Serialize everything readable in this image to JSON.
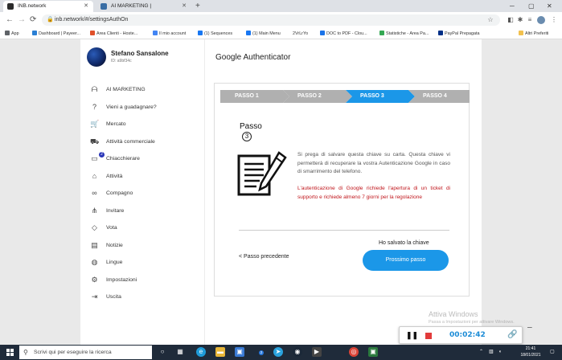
{
  "browser": {
    "tabs": [
      {
        "label": "INB.network",
        "favicon_color": "#2b2b2b",
        "active": true
      },
      {
        "label": "AI MARKETING |",
        "favicon_color": "#3a6ea5",
        "active": false
      }
    ],
    "new_tab": "+",
    "window_controls": {
      "minimize": "─",
      "maximize": "▢",
      "close": "✕"
    },
    "nav": {
      "back": "←",
      "forward": "→",
      "reload": "⟳"
    },
    "url": "inb.network/#/settingsAuthOn",
    "bookmarks": [
      {
        "label": "App",
        "color": "#5f6368"
      },
      {
        "label": "Dashboard | Payeer...",
        "color": "#2a7fd4"
      },
      {
        "label": "Area Clienti - Hoste...",
        "color": "#e0502a"
      },
      {
        "label": "Il mio account",
        "color": "#4285f4"
      },
      {
        "label": "(1) Sequences",
        "color": "#1877f2"
      },
      {
        "label": "(1) Main Menu",
        "color": "#1877f2"
      },
      {
        "label": "2VrLrYo",
        "color": "#9e9e9e"
      },
      {
        "label": "DOC to PDF - Clou...",
        "color": "#1a73e8"
      },
      {
        "label": "Statistiche - Area Pa...",
        "color": "#34a853"
      },
      {
        "label": "PayPal Prepagata",
        "color": "#003087"
      }
    ],
    "other_bookmarks": "Altri Preferiti"
  },
  "user": {
    "name": "Stefano Sansalone",
    "id": "ID: a9bf34c"
  },
  "sidebar": {
    "items": [
      {
        "label": "AI MARKETING",
        "icon": "ai-marketing-icon",
        "glyph": "ᗩ"
      },
      {
        "label": "Vieni a guadagnare?",
        "icon": "question-icon",
        "glyph": "?"
      },
      {
        "label": "Mercato",
        "icon": "cart-icon",
        "glyph": "🛒"
      },
      {
        "label": "Attività commerciale",
        "icon": "truck-icon",
        "glyph": "⛟"
      },
      {
        "label": "Chiacchierare",
        "icon": "chat-icon",
        "glyph": "▭",
        "badge": "2"
      },
      {
        "label": "Attività",
        "icon": "bank-icon",
        "glyph": "⌂"
      },
      {
        "label": "Compagno",
        "icon": "handshake-icon",
        "glyph": "∞"
      },
      {
        "label": "Invitare",
        "icon": "share-icon",
        "glyph": "⋔"
      },
      {
        "label": "Vota",
        "icon": "vote-icon",
        "glyph": "◇"
      },
      {
        "label": "Notizie",
        "icon": "news-icon",
        "glyph": "▤"
      },
      {
        "label": "Lingue",
        "icon": "globe-icon",
        "glyph": "◍"
      },
      {
        "label": "Impostazioni",
        "icon": "settings-icon",
        "glyph": "⚙"
      },
      {
        "label": "Uscita",
        "icon": "logout-icon",
        "glyph": "⇥"
      }
    ]
  },
  "main": {
    "title": "Google Authenticator",
    "steps": [
      {
        "label": "PASSO 1",
        "state": "done"
      },
      {
        "label": "PASSO 2",
        "state": "done"
      },
      {
        "label": "PASSO 3",
        "state": "active"
      },
      {
        "label": "PASSO 4",
        "state": "todo"
      }
    ],
    "step_heading": "Passo",
    "step_number": "3",
    "info_text": "Si prega di salvare questa chiave su carta. Questa chiave vi permetterà di recuperare la vostra Autenticazione Google in caso di smarrimento del telefono.",
    "warning_text": "L'autenticazione di Google richiede l'apertura di un ticket di supporto e richiede almeno 7 giorni per la regolazione",
    "prev_link": "< Passo precedente",
    "saved_label": "Ho salvato la chiave",
    "next_button": "Prossimo passo",
    "accent_color": "#1b97e8",
    "warning_color": "#c0161c"
  },
  "watermark": {
    "title": "Attiva Windows",
    "subtitle": "Passa a Impostazioni per attivare Windows."
  },
  "recorder": {
    "time": "00:02:42",
    "pause": "❚❚",
    "link": "🔗",
    "minimize": "─"
  },
  "taskbar": {
    "search_placeholder": "Scrivi qui per eseguire la ricerca",
    "apps": [
      {
        "name": "task-view",
        "glyph": "○",
        "color": "transparent"
      },
      {
        "name": "multitask",
        "glyph": "▦",
        "color": "transparent"
      },
      {
        "name": "edge",
        "glyph": "e",
        "color": "#1f9bd8"
      },
      {
        "name": "file-explorer",
        "glyph": "▬",
        "color": "#e8b73a"
      },
      {
        "name": "store",
        "glyph": "▣",
        "color": "#3a7bd5"
      },
      {
        "name": "telegram",
        "glyph": "➤",
        "color": "#2aa3de"
      },
      {
        "name": "steam",
        "glyph": "◉",
        "color": "#1b2838"
      },
      {
        "name": "media",
        "glyph": "▶",
        "color": "#444"
      },
      {
        "name": "chrome",
        "glyph": "◎",
        "color": "#db4437"
      },
      {
        "name": "app",
        "glyph": "▣",
        "color": "#2b7a3e"
      }
    ],
    "badge_count": "2",
    "time": "21:41",
    "date": "18/01/2021"
  }
}
